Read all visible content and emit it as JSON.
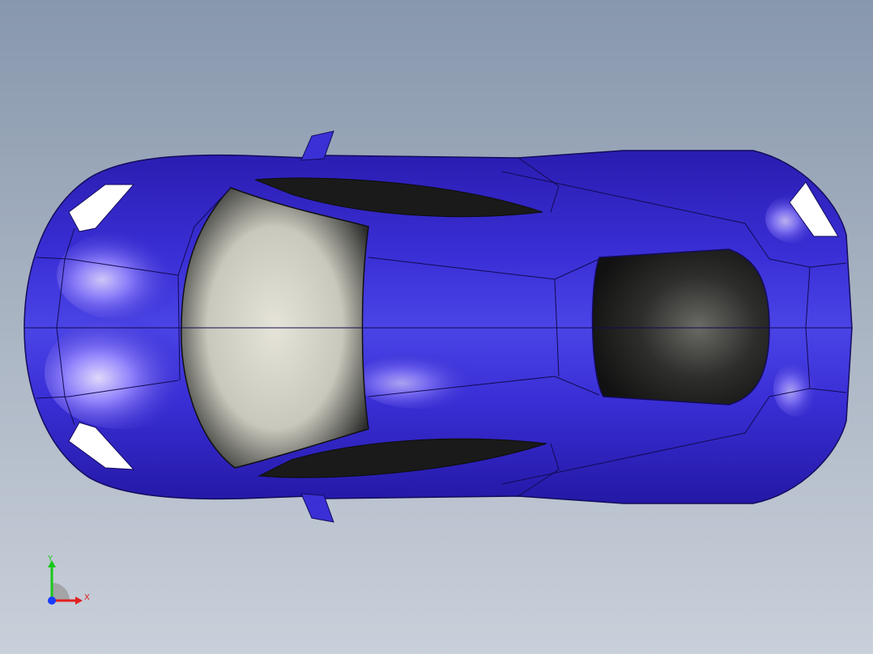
{
  "viewport": {
    "background_top": "#8797ad",
    "background_bottom": "#c9d0da"
  },
  "model": {
    "body_color": "#2a1fb8",
    "body_highlight": "#8f86ff",
    "glass_color": "#1a1a1a",
    "windshield_color": "#d9d9cf"
  },
  "triad": {
    "x_label": "X",
    "y_label": "Y",
    "x_color": "#e22020",
    "y_color": "#18c818",
    "z_color": "#1a3cff"
  }
}
